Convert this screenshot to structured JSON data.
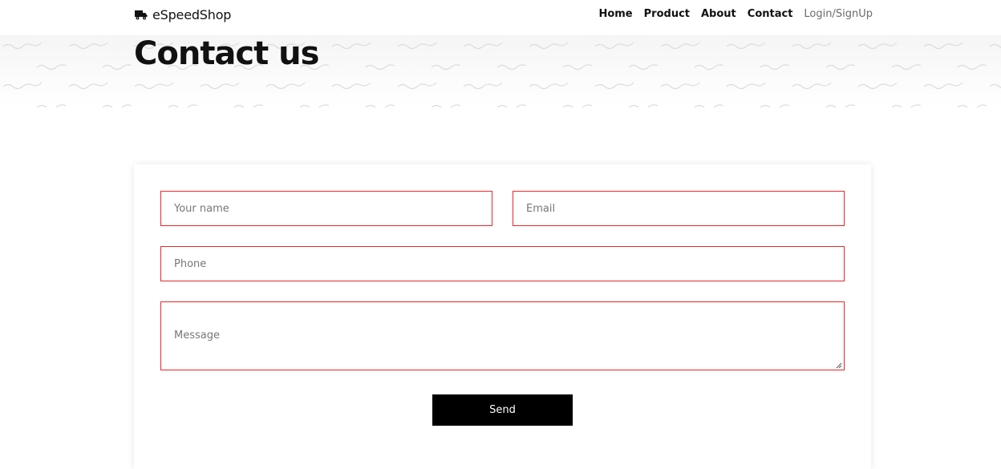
{
  "navbar": {
    "brand": "eSpeedShop",
    "brand_icon": "truck-icon",
    "links": [
      "Home",
      "Product",
      "About",
      "Contact",
      "Login/SignUp"
    ]
  },
  "hero": {
    "title": "Contact us"
  },
  "form": {
    "name_placeholder": "Your name",
    "email_placeholder": "Email",
    "phone_placeholder": "Phone",
    "message_placeholder": "Message",
    "send_label": "Send"
  },
  "colors": {
    "field_border": "#e8262a",
    "button_bg": "#000000",
    "text": "#111111",
    "muted_link": "#6b6b6b"
  }
}
